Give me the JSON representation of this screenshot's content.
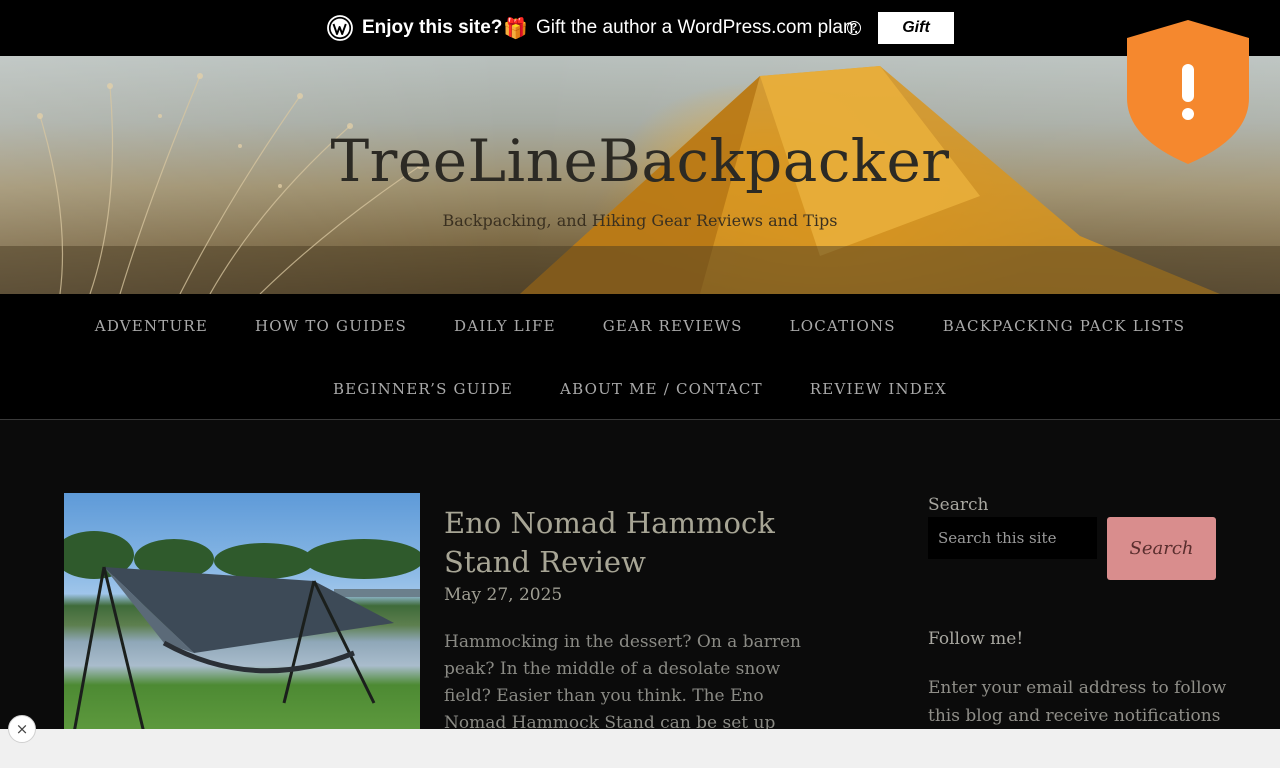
{
  "promo": {
    "enjoy": "Enjoy this site?",
    "gift_text": "Gift the author a WordPress.com plan.",
    "gift_button": "Gift"
  },
  "site": {
    "title": "TreeLineBackpacker",
    "tagline": "Backpacking, and Hiking Gear Reviews and Tips"
  },
  "nav": {
    "row1": [
      "ADVENTURE",
      "HOW TO GUIDES",
      "DAILY LIFE",
      "GEAR REVIEWS",
      "LOCATIONS",
      "BACKPACKING PACK LISTS"
    ],
    "row2": [
      "BEGINNER’S GUIDE",
      "ABOUT ME / CONTACT",
      "REVIEW INDEX"
    ]
  },
  "post": {
    "title": "Eno Nomad Hammock Stand Review",
    "date": "May 27, 2025",
    "excerpt": "Hammocking in the dessert? On a barren peak? In the middle of a desolate snow field? Easier than you think. The Eno Nomad Hammock Stand can be set up anywhere."
  },
  "sidebar": {
    "search_label": "Search",
    "search_placeholder": "Search this site",
    "search_button": "Search",
    "follow_title": "Follow me!",
    "follow_text": "Enter your email address to follow this blog and receive notifications"
  },
  "ad": {
    "close": "×"
  },
  "colors": {
    "accent_button": "#d98d8d",
    "shield": "#f5882e",
    "nav_bg": "#000000",
    "page_bg": "#0b0b0b"
  }
}
